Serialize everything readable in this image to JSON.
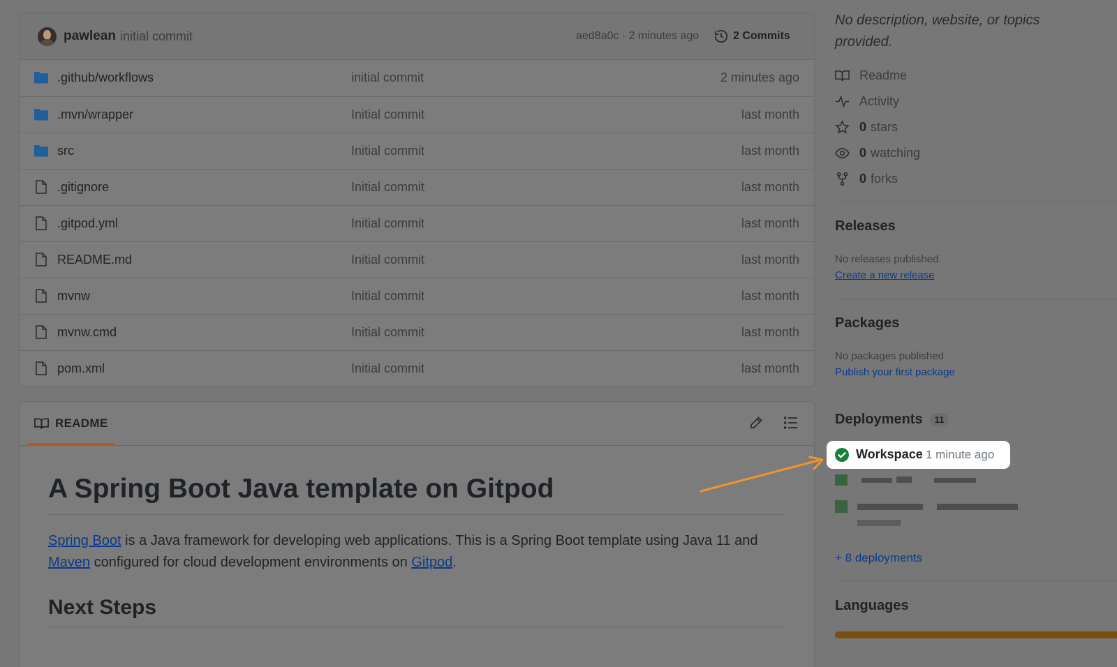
{
  "commit_bar": {
    "author": "pawlean",
    "message": "initial commit",
    "meta": "aed8a0c · 2 minutes ago",
    "commits_label": "2 Commits"
  },
  "files": [
    {
      "type": "folder",
      "name": ".github/workflows",
      "commit": "initial commit",
      "date": "2 minutes ago"
    },
    {
      "type": "folder",
      "name": ".mvn/wrapper",
      "commit": "Initial commit",
      "date": "last month"
    },
    {
      "type": "folder",
      "name": "src",
      "commit": "Initial commit",
      "date": "last month"
    },
    {
      "type": "file",
      "name": ".gitignore",
      "commit": "Initial commit",
      "date": "last month"
    },
    {
      "type": "file",
      "name": ".gitpod.yml",
      "commit": "Initial commit",
      "date": "last month"
    },
    {
      "type": "file",
      "name": "README.md",
      "commit": "Initial commit",
      "date": "last month"
    },
    {
      "type": "file",
      "name": "mvnw",
      "commit": "Initial commit",
      "date": "last month"
    },
    {
      "type": "file",
      "name": "mvnw.cmd",
      "commit": "Initial commit",
      "date": "last month"
    },
    {
      "type": "file",
      "name": "pom.xml",
      "commit": "Initial commit",
      "date": "last month"
    }
  ],
  "readme": {
    "tab_label": "README",
    "title": "A Spring Boot Java template on Gitpod",
    "link_spring_boot": "Spring Boot",
    "text_1": " is a Java framework for developing web applications. This is a Spring Boot template using Java 11 and ",
    "link_maven": "Maven",
    "text_2": " configured for cloud development environments on ",
    "link_gitpod": "Gitpod",
    "text_3": ".",
    "next_steps": "Next Steps"
  },
  "sidebar": {
    "about_description": "No description, website, or topics provided.",
    "readme_link": "Readme",
    "activity_link": "Activity",
    "stars_count": "0",
    "stars_label": "stars",
    "watching_count": "0",
    "watching_label": "watching",
    "forks_count": "0",
    "forks_label": "forks",
    "releases_title": "Releases",
    "releases_note": "No releases published",
    "releases_link": "Create a new release",
    "packages_title": "Packages",
    "packages_note": "No packages published",
    "packages_link": "Publish your first package",
    "deployments_title": "Deployments",
    "deployments_count": "11",
    "deploy_name": "Workspace",
    "deploy_time": "1 minute ago",
    "more_deployments": "+ 8 deployments",
    "languages_title": "Languages"
  },
  "colors": {
    "overlay_bg": "#777777",
    "highlight_bg": "#ffffff",
    "success_green": "#1a7f37",
    "arrow": "#f0952c",
    "link_blue": "#0a3a8c",
    "language_bar": "#7a4f10"
  },
  "icons": {
    "folder": "folder-icon",
    "file": "file-icon",
    "history": "history-icon",
    "book": "book-icon",
    "pencil": "pencil-icon",
    "list": "list-icon",
    "activity": "pulse-icon",
    "star": "star-icon",
    "eye": "eye-icon",
    "fork": "fork-icon",
    "check": "check-circle-icon"
  }
}
